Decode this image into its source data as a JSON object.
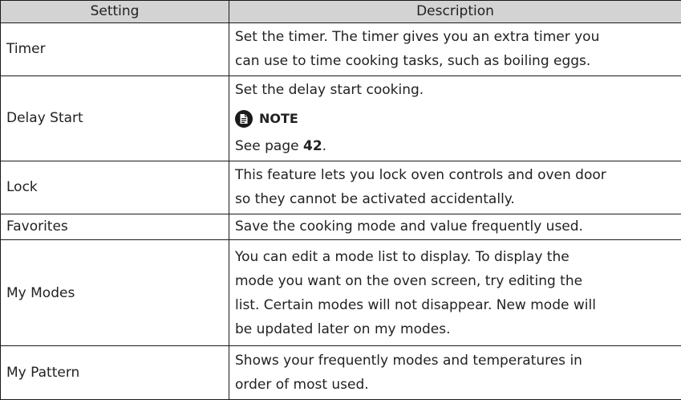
{
  "headers": [
    "Setting",
    "Description"
  ],
  "rows": [
    {
      "setting": "Timer",
      "description": [
        "Set the timer. The timer gives you an extra timer you",
        "can use to time cooking tasks, such as boiling eggs."
      ]
    },
    {
      "setting": "Delay Start",
      "description": [
        "Set the delay start cooking."
      ],
      "note": {
        "label": "NOTE",
        "text_prefix": "See page ",
        "page": "42",
        "text_suffix": "."
      }
    },
    {
      "setting": "Lock",
      "description": [
        "This feature lets you lock oven controls and oven door",
        "so they cannot be activated accidentally."
      ]
    },
    {
      "setting": "Favorites",
      "description": [
        "Save the cooking mode and value frequently used."
      ]
    },
    {
      "setting": "My Modes",
      "description": [
        "You can edit a mode list to display. To display the",
        "mode you want on the oven screen, try editing the",
        "list. Certain modes will not disappear. New mode will",
        "be updated later on my modes."
      ]
    },
    {
      "setting": "My Pattern",
      "description": [
        "Shows your frequently modes and temperatures in",
        "order of most used."
      ]
    }
  ],
  "icons": {
    "note": "note-document-icon"
  }
}
